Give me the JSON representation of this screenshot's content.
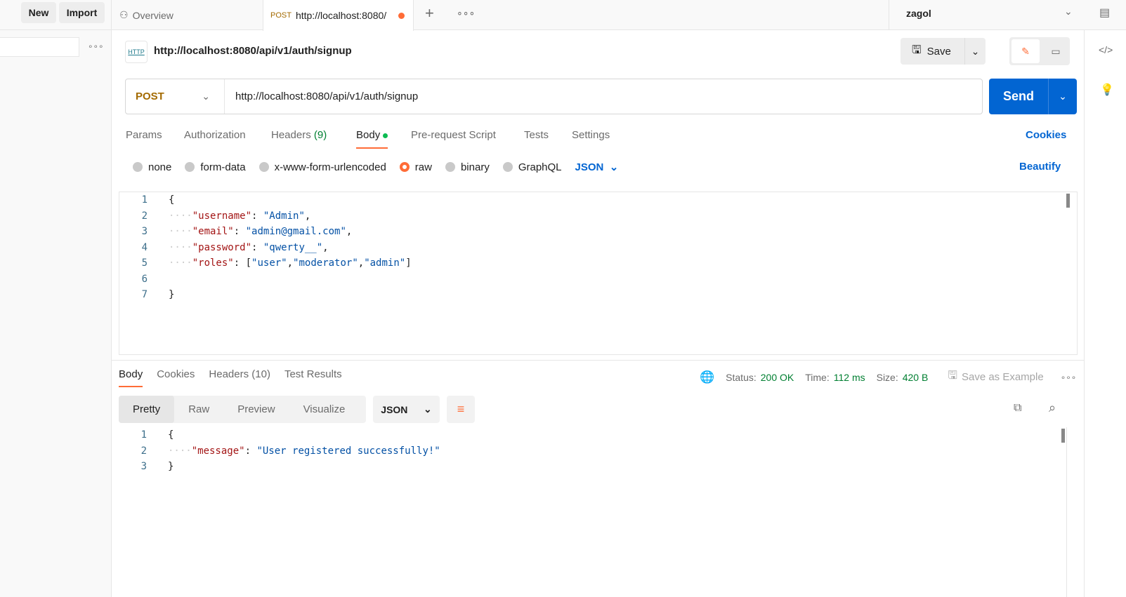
{
  "topbar": {
    "new": "New",
    "import": "Import",
    "tabs": [
      {
        "label": "Overview",
        "icon": "overview-icon"
      },
      {
        "method": "POST",
        "label": "http://localhost:8080/",
        "unsaved": true
      }
    ],
    "workspace": "zagol"
  },
  "request": {
    "title": "http://localhost:8080/api/v1/auth/signup",
    "save": "Save",
    "method": "POST",
    "url": "http://localhost:8080/api/v1/auth/signup",
    "send": "Send",
    "tabs": [
      {
        "label": "Params"
      },
      {
        "label": "Authorization"
      },
      {
        "label": "Headers",
        "count": "(9)"
      },
      {
        "label": "Body",
        "active": true
      },
      {
        "label": "Pre-request Script"
      },
      {
        "label": "Tests"
      },
      {
        "label": "Settings"
      }
    ],
    "cookies": "Cookies",
    "body_types": [
      {
        "label": "none"
      },
      {
        "label": "form-data"
      },
      {
        "label": "x-www-form-urlencoded"
      },
      {
        "label": "raw",
        "selected": true
      },
      {
        "label": "binary"
      },
      {
        "label": "GraphQL"
      }
    ],
    "format": "JSON",
    "beautify": "Beautify",
    "lines": [
      [
        "{"
      ],
      [
        "    ",
        "\"username\"",
        ": ",
        "\"Admin\"",
        ","
      ],
      [
        "    ",
        "\"email\"",
        ": ",
        "\"admin@gmail.com\"",
        ","
      ],
      [
        "    ",
        "\"password\"",
        ": ",
        "\"qwerty__\"",
        ","
      ],
      [
        "    ",
        "\"roles\"",
        ": [",
        "\"user\"",
        ",",
        "\"moderator\"",
        ",",
        "\"admin\"",
        "]"
      ],
      [
        ""
      ],
      [
        "}"
      ]
    ]
  },
  "response": {
    "tabs": [
      {
        "label": "Body",
        "active": true
      },
      {
        "label": "Cookies"
      },
      {
        "label": "Headers (10)"
      },
      {
        "label": "Test Results"
      }
    ],
    "status_label": "Status:",
    "status": "200 OK",
    "time_label": "Time:",
    "time": "112 ms",
    "size_label": "Size:",
    "size": "420 B",
    "save_example": "Save as Example",
    "views": [
      "Pretty",
      "Raw",
      "Preview",
      "Visualize"
    ],
    "format": "JSON",
    "lines": [
      [
        "{"
      ],
      [
        "    ",
        "\"message\"",
        ": ",
        "\"User registered successfully!\""
      ],
      [
        "}"
      ]
    ]
  },
  "colors": {
    "accent": "#ff6c37",
    "send": "#0265d2",
    "link": "#0265d2",
    "green": "#007f31",
    "method": "#a36a00"
  }
}
